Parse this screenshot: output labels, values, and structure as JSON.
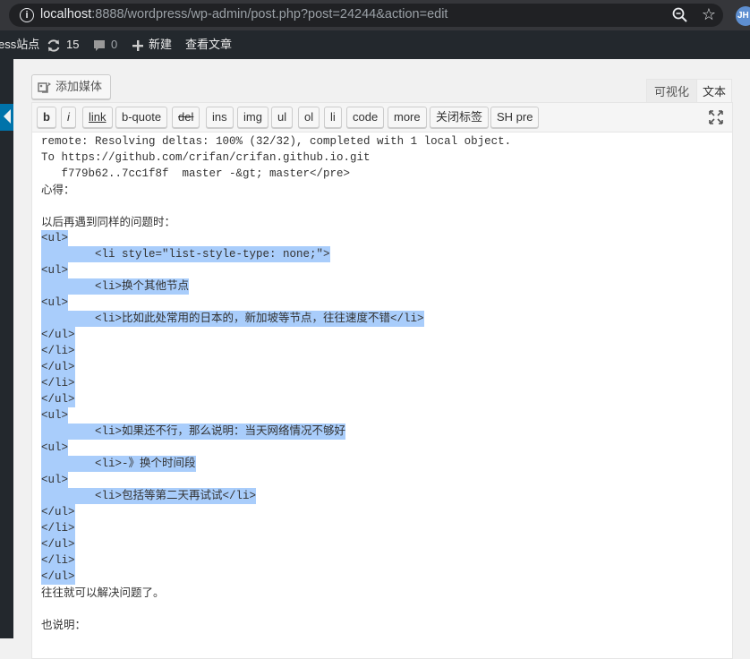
{
  "browser": {
    "url_host": "localhost",
    "url_rest": ":8888/wordpress/wp-admin/post.php?post=24244&action=edit",
    "profile_initials": "JH"
  },
  "admin_bar": {
    "site_name": "ess站点",
    "updates_count": "15",
    "comments_count": "0",
    "new_label": "新建",
    "view_post_label": "查看文章"
  },
  "editor": {
    "add_media_label": "添加媒体",
    "tabs": {
      "visual": "可视化",
      "text": "文本"
    },
    "quicktags": [
      "b",
      "i",
      "link",
      "b-quote",
      "del",
      "ins",
      "img",
      "ul",
      "ol",
      "li",
      "code",
      "more",
      "关闭标签",
      "SH pre"
    ],
    "lines": [
      "remote: Resolving deltas: 100% (32/32), completed with 1 local object.",
      "To https://github.com/crifan/crifan.github.io.git",
      "   f779b62..7cc1f8f  master -&gt; master</pre>",
      "心得：",
      "",
      "以后再遇到同样的问题时：",
      "<ul>",
      "        <li style=\"list-style-type: none;\">",
      "<ul>",
      "        <li>换个其他节点",
      "<ul>",
      "        <li>比如此处常用的日本的，新加坡等节点，往往速度不错</li>",
      "</ul>",
      "</li>",
      "</ul>",
      "</li>",
      "</ul>",
      "<ul>",
      "        <li>如果还不行，那么说明：当天网络情况不够好",
      "<ul>",
      "        <li>-》换个时间段",
      "<ul>",
      "        <li>包括等第二天再试试</li>",
      "</ul>",
      "</li>",
      "</ul>",
      "</li>",
      "</ul>",
      "往往就可以解决问题了。",
      "",
      "也说明："
    ]
  }
}
